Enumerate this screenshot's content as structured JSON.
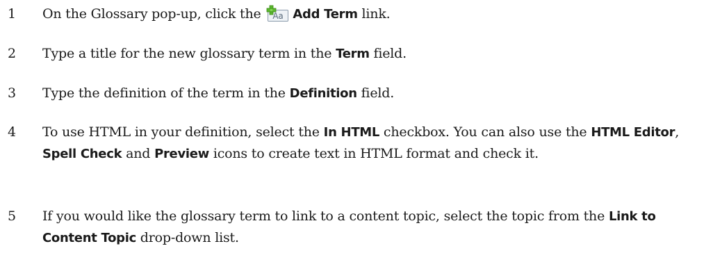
{
  "steps": [
    {
      "number": "1",
      "parts": [
        "On the Glossary pop-up, click the ",
        "Add Term",
        " link."
      ]
    },
    {
      "number": "2",
      "parts": [
        "Type a title for the new glossary term in the ",
        "Term",
        " field."
      ]
    },
    {
      "number": "3",
      "parts": [
        "Type the definition of the term in the ",
        "Definition",
        " field."
      ]
    },
    {
      "number": "4",
      "parts": [
        "To use HTML in your definition, select the ",
        "In HTML",
        " checkbox. You can also use the ",
        "HTML Editor",
        ", ",
        "Spell Check",
        " and ",
        "Preview",
        " icons to create text in HTML format and check it."
      ]
    },
    {
      "number": "5",
      "parts": [
        "If you would like the glossary term to link to a content topic, select the topic from the ",
        "Link to Content Topic",
        " drop-down list."
      ]
    }
  ],
  "icons": {
    "add_term": {
      "name": "add-term-icon",
      "glyph": "Aa",
      "plus_color": "#5cb82e",
      "frame_color": "#8a9aab"
    }
  }
}
